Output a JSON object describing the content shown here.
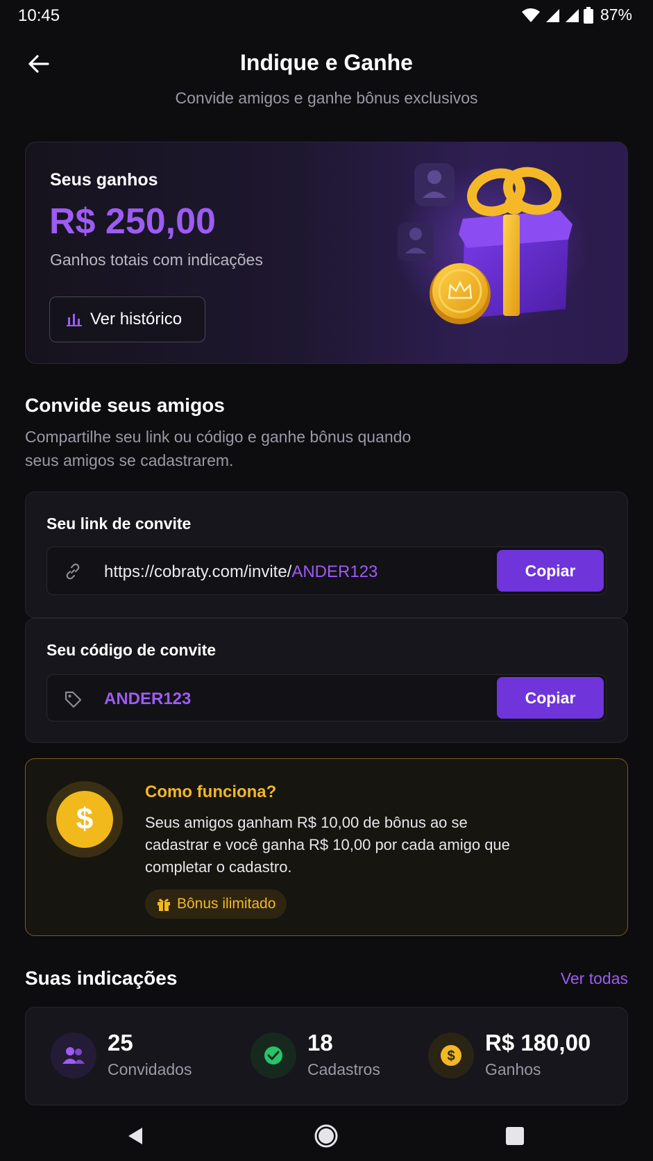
{
  "status": {
    "time": "10:45",
    "battery": "87%"
  },
  "header": {
    "title": "Indique e Ganhe",
    "subtitle": "Convide amigos e ganhe bônus exclusivos"
  },
  "earnings": {
    "label": "Seus ganhos",
    "value": "R$ 250,00",
    "description": "Ganhos totais com indicações",
    "history_button": "Ver histórico"
  },
  "invite_section": {
    "title": "Convide seus amigos",
    "description": "Compartilhe seu link ou código e ganhe bônus quando seus amigos se cadastrarem."
  },
  "invite_link": {
    "label": "Seu link de convite",
    "url_prefix": "https://cobraty.com/invite/",
    "url_code": "ANDER123",
    "copy_label": "Copiar"
  },
  "invite_code": {
    "label": "Seu código de convite",
    "code": "ANDER123",
    "copy_label": "Copiar"
  },
  "how_it_works": {
    "title": "Como funciona?",
    "text": "Seus amigos ganham R$ 10,00 de bônus ao se cadastrar e você ganha R$ 10,00 por cada amigo que completar o cadastro.",
    "badge": "Bônus ilimitado",
    "coin_symbol": "$"
  },
  "referrals": {
    "title": "Suas indicações",
    "see_all": "Ver todas",
    "stats": [
      {
        "value": "25",
        "caption": "Convidados",
        "icon": "users-icon"
      },
      {
        "value": "18",
        "caption": "Cadastros",
        "icon": "check-icon"
      },
      {
        "value": "R$ 180,00",
        "caption": "Ganhos",
        "icon": "dollar-coin-icon"
      }
    ]
  },
  "colors": {
    "accent": "#9d5cf3",
    "button": "#6f34da",
    "gold": "#f2b824",
    "background": "#0d0d10"
  }
}
